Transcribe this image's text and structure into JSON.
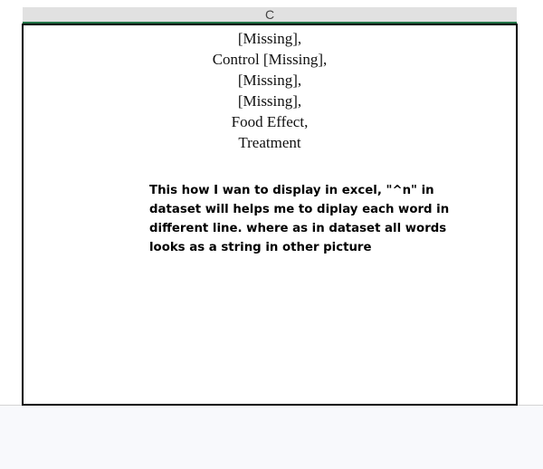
{
  "column_header": {
    "label": "C"
  },
  "cell": {
    "lines": [
      "[Missing],",
      "Control [Missing],",
      "[Missing],",
      "[Missing],",
      "Food Effect,",
      "Treatment"
    ]
  },
  "note": {
    "text": "This how I wan to display in excel, \"^n\" in dataset will helps me to diplay each word in different line. where as in dataset all words looks as a string in other picture"
  },
  "colors": {
    "header_fill": "#e1e1e1",
    "header_accent": "#217346",
    "cell_border": "#000000",
    "gridline": "#d4d4d4"
  }
}
